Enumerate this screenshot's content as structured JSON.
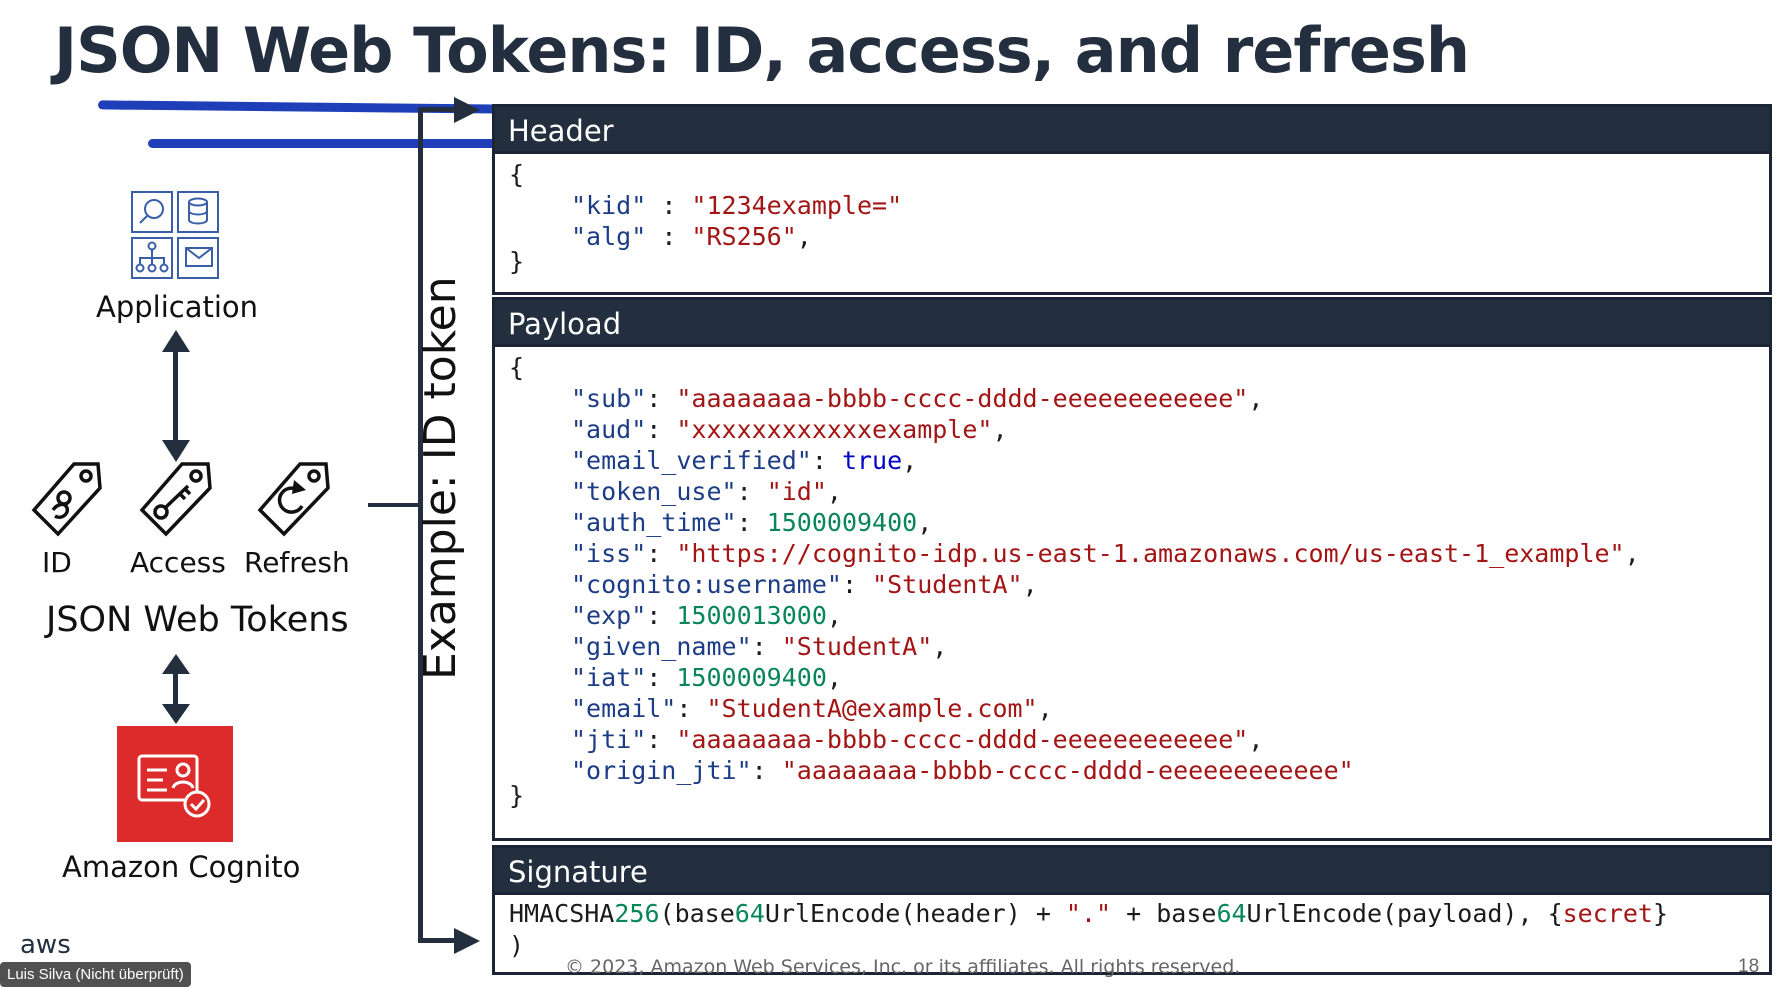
{
  "title": "JSON Web Tokens: ID, access, and refresh",
  "colors": {
    "dark": "#232f3e",
    "annotation_blue": "#1e3fb8",
    "cognito_red": "#dd2b2b",
    "string": "#a31515",
    "number": "#098658",
    "keyword": "#0000c8",
    "key": "#1c3d86"
  },
  "left": {
    "application_label": "Application",
    "tokens": [
      {
        "label": "ID",
        "icon": "id-tag-icon"
      },
      {
        "label": "Access",
        "icon": "key-tag-icon"
      },
      {
        "label": "Refresh",
        "icon": "refresh-tag-icon"
      }
    ],
    "tokens_label": "JSON Web Tokens",
    "cognito_label": "Amazon Cognito"
  },
  "vertical_label": "Example: ID token",
  "header": {
    "label": "Header",
    "open": "{",
    "close": "}",
    "entries": [
      {
        "key": "\"kid\"",
        "sep": " : ",
        "value": "\"1234example=\"",
        "type": "str",
        "trail": ""
      },
      {
        "key": "\"alg\"",
        "sep": " : ",
        "value": "\"RS256\"",
        "type": "str",
        "trail": ","
      }
    ]
  },
  "payload": {
    "label": "Payload",
    "open": "{",
    "close": "}",
    "entries": [
      {
        "key": "\"sub\"",
        "sep": ": ",
        "value": "\"aaaaaaaa-bbbb-cccc-dddd-eeeeeeeeeeee\"",
        "type": "str",
        "trail": ","
      },
      {
        "key": "\"aud\"",
        "sep": ": ",
        "value": "\"xxxxxxxxxxxxexample\"",
        "type": "str",
        "trail": ","
      },
      {
        "key": "\"email_verified\"",
        "sep": ": ",
        "value": "true",
        "type": "kw",
        "trail": ","
      },
      {
        "key": "\"token_use\"",
        "sep": ": ",
        "value": "\"id\"",
        "type": "str",
        "trail": ","
      },
      {
        "key": "\"auth_time\"",
        "sep": ": ",
        "value": "1500009400",
        "type": "num",
        "trail": ","
      },
      {
        "key": "\"iss\"",
        "sep": ": ",
        "value": "\"https://cognito-idp.us-east-1.amazonaws.com/us-east-1_example\"",
        "type": "str",
        "trail": ","
      },
      {
        "key": "\"cognito:username\"",
        "sep": ": ",
        "value": "\"StudentA\"",
        "type": "str",
        "trail": ","
      },
      {
        "key": "\"exp\"",
        "sep": ": ",
        "value": "1500013000",
        "type": "num",
        "trail": ","
      },
      {
        "key": "\"given_name\"",
        "sep": ": ",
        "value": "\"StudentA\"",
        "type": "str",
        "trail": ","
      },
      {
        "key": "\"iat\"",
        "sep": ": ",
        "value": "1500009400",
        "type": "num",
        "trail": ","
      },
      {
        "key": "\"email\"",
        "sep": ": ",
        "value": "\"StudentA@example.com\"",
        "type": "str",
        "trail": ","
      },
      {
        "key": "\"jti\"",
        "sep": ": ",
        "value": "\"aaaaaaaa-bbbb-cccc-dddd-eeeeeeeeeeee\"",
        "type": "str",
        "trail": ","
      },
      {
        "key": "\"origin_jti\"",
        "sep": ": ",
        "value": "\"aaaaaaaa-bbbb-cccc-dddd-eeeeeeeeeeee\"",
        "type": "str",
        "trail": ""
      }
    ]
  },
  "signature": {
    "label": "Signature",
    "line1": [
      {
        "t": "HMACSHA",
        "c": "punct"
      },
      {
        "t": "256",
        "c": "num"
      },
      {
        "t": "(base",
        "c": "punct"
      },
      {
        "t": "64",
        "c": "num"
      },
      {
        "t": "UrlEncode(header) + ",
        "c": "punct"
      },
      {
        "t": "\".\"",
        "c": "str"
      },
      {
        "t": " + base",
        "c": "punct"
      },
      {
        "t": "64",
        "c": "num"
      },
      {
        "t": "UrlEncode(payload), {",
        "c": "punct"
      },
      {
        "t": "secret",
        "c": "str"
      },
      {
        "t": "}",
        "c": "punct"
      }
    ],
    "line2": ")"
  },
  "footer": "© 2023, Amazon Web Services, Inc. or its affiliates. All rights reserved.",
  "page_number": "18",
  "aws_logo": "aws",
  "speaker_tag": "Luis Silva (Nicht überprüft)"
}
